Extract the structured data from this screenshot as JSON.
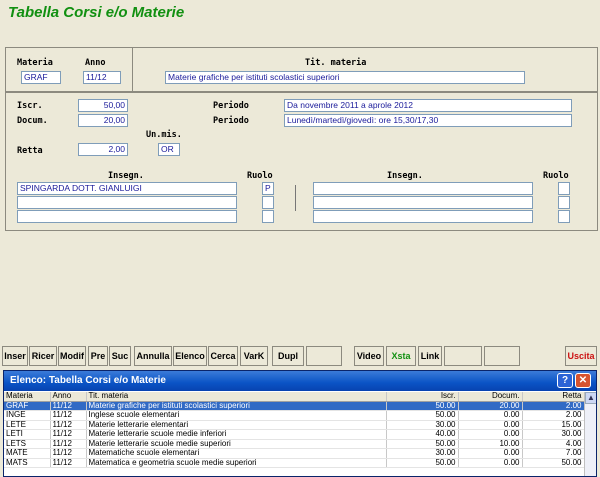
{
  "window": {
    "title": "Tabella Corsi e/o Materie"
  },
  "form": {
    "materia_label": "Materia",
    "materia": "GRAF",
    "anno_label": "Anno",
    "anno": "11/12",
    "tit_label": "Tit. materia",
    "tit": "Materie grafiche per istituti scolastici superiori",
    "iscr_label": "Iscr.",
    "iscr": "50,00",
    "docum_label": "Docum.",
    "docum": "20,00",
    "um_label": "Un.mis.",
    "um": "OR",
    "retta_label": "Retta",
    "retta": "2,00",
    "periodo_label": "Periodo",
    "periodo1": "Da novembre 2011 a aprole 2012",
    "periodo2": "Lunedì/martedì/giovedì: ore 15,30/17,30",
    "insegn_label": "Insegn.",
    "ruolo_label": "Ruolo",
    "insegn_left": [
      "SPINGARDA DOTT. GIANLUIGI",
      "",
      ""
    ],
    "ruolo_left": [
      "P",
      "",
      ""
    ],
    "insegn_right": [
      "",
      "",
      ""
    ],
    "ruolo_right": [
      "",
      "",
      ""
    ]
  },
  "toolbar": {
    "inser": "Inser",
    "ricer": "Ricer",
    "modif": "Modif",
    "pre": "Pre",
    "suc": "Suc",
    "annulla": "Annulla",
    "elenco": "Elenco",
    "cerca": "Cerca",
    "vark": "VarK",
    "dupl": "Dupl",
    "video": "Video",
    "xsta": "Xsta",
    "link": "Link",
    "uscita": "Uscita"
  },
  "colors": {
    "title": "#119011",
    "xsta": "#119011",
    "uscita": "#cc1111",
    "selected_row": "#316ac5",
    "field_text": "#1a1a9a"
  },
  "list": {
    "title": "Elenco: Tabella Corsi e/o Materie",
    "columns": [
      "Materia",
      "Anno",
      "Tit. materia",
      "Iscr.",
      "Docum.",
      "Retta"
    ],
    "rows": [
      [
        "GRAF",
        "11/12",
        "Materie grafiche per istituti scolastici superiori",
        "50.00",
        "20.00",
        "2.00"
      ],
      [
        "INGE",
        "11/12",
        "Inglese scuole elementari",
        "50.00",
        "0.00",
        "2.00"
      ],
      [
        "LETE",
        "11/12",
        "Materie letterarie elementari",
        "30.00",
        "0.00",
        "15.00"
      ],
      [
        "LETI",
        "11/12",
        "Materie letterarie scuole medie inferiori",
        "40.00",
        "0.00",
        "30.00"
      ],
      [
        "LETS",
        "11/12",
        "Materie letterarie scuole medie superiori",
        "50.00",
        "10.00",
        "4.00"
      ],
      [
        "MATE",
        "11/12",
        "Matematiche scuole elementari",
        "30.00",
        "0.00",
        "7.00"
      ],
      [
        "MATS",
        "11/12",
        "Matematica e geometria scuole medie superiori",
        "50.00",
        "0.00",
        "50.00"
      ]
    ],
    "selected_index": 0
  }
}
